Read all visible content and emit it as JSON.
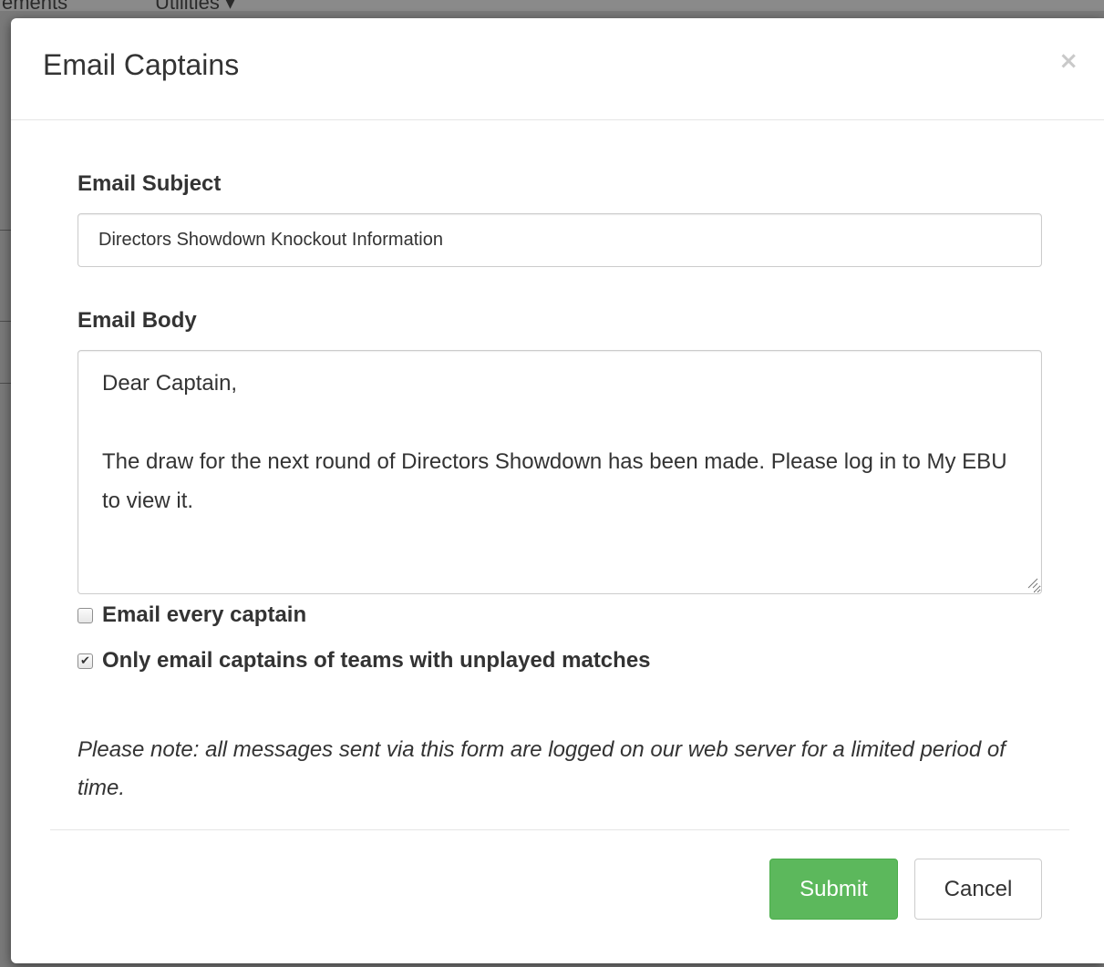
{
  "background": {
    "nav_items": [
      "ements",
      "Utilities ▾"
    ]
  },
  "modal": {
    "title": "Email Captains",
    "close_glyph": "×"
  },
  "form": {
    "subject_label": "Email Subject",
    "subject_value": "Directors Showdown Knockout Information",
    "body_label": "Email Body",
    "body_value": "Dear Captain,\n\nThe draw for the next round of Directors Showdown has been made. Please log in to My EBU to view it.",
    "every_captain_label": "Email every captain",
    "every_captain_checked": false,
    "unplayed_label": "Only email captains of teams with unplayed matches",
    "unplayed_checked": true,
    "note": "Please note: all messages sent via this form are logged on our web server for a limited period of time."
  },
  "footer": {
    "submit_label": "Submit",
    "cancel_label": "Cancel"
  },
  "colors": {
    "submit_bg": "#5cb85c",
    "text": "#333333",
    "border": "#cccccc"
  }
}
